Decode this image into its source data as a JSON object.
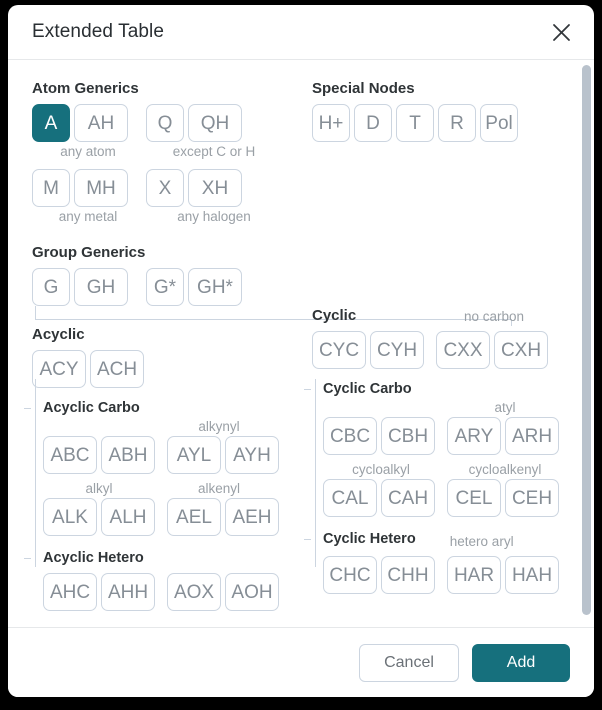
{
  "dialog": {
    "title": "Extended Table",
    "close_icon": "close-icon"
  },
  "sections": {
    "atom_generics": {
      "title": "Atom Generics",
      "row1": [
        {
          "label": "A",
          "selected": true
        },
        {
          "label": "AH",
          "selected": false
        },
        {
          "label": "Q",
          "selected": false
        },
        {
          "label": "QH",
          "selected": false
        }
      ],
      "row1_captions": [
        "any atom",
        "except C or H"
      ],
      "row2": [
        {
          "label": "M",
          "selected": false
        },
        {
          "label": "MH",
          "selected": false
        },
        {
          "label": "X",
          "selected": false
        },
        {
          "label": "XH",
          "selected": false
        }
      ],
      "row2_captions": [
        "any metal",
        "any halogen"
      ]
    },
    "special_nodes": {
      "title": "Special Nodes",
      "items": [
        {
          "label": "H+"
        },
        {
          "label": "D"
        },
        {
          "label": "T"
        },
        {
          "label": "R"
        },
        {
          "label": "Pol"
        }
      ]
    },
    "group_generics": {
      "title": "Group Generics",
      "items": [
        {
          "label": "G"
        },
        {
          "label": "GH"
        },
        {
          "label": "G*"
        },
        {
          "label": "GH*"
        }
      ]
    },
    "acyclic": {
      "title": "Acyclic",
      "items": [
        {
          "label": "ACY"
        },
        {
          "label": "ACH"
        }
      ],
      "carbo": {
        "title": "Acyclic Carbo",
        "row1_caption_right": "alkynyl",
        "row1": [
          {
            "label": "ABC"
          },
          {
            "label": "ABH"
          },
          {
            "label": "AYL"
          },
          {
            "label": "AYH"
          }
        ],
        "row2_caption_left": "alkyl",
        "row2_caption_right": "alkenyl",
        "row2": [
          {
            "label": "ALK"
          },
          {
            "label": "ALH"
          },
          {
            "label": "AEL"
          },
          {
            "label": "AEH"
          }
        ]
      },
      "hetero": {
        "title": "Acyclic Hetero",
        "row1": [
          {
            "label": "AHC"
          },
          {
            "label": "AHH"
          },
          {
            "label": "AOX"
          },
          {
            "label": "AOH"
          }
        ]
      }
    },
    "cyclic": {
      "title": "Cyclic",
      "caption_right": "no carbon",
      "items": [
        {
          "label": "CYC"
        },
        {
          "label": "CYH"
        },
        {
          "label": "CXX"
        },
        {
          "label": "CXH"
        }
      ],
      "carbo": {
        "title": "Cyclic Carbo",
        "row1_caption_right": "atyl",
        "row1": [
          {
            "label": "CBC"
          },
          {
            "label": "CBH"
          },
          {
            "label": "ARY"
          },
          {
            "label": "ARH"
          }
        ],
        "row2_caption_left": "cycloalkyl",
        "row2_caption_right": "cycloalkenyl",
        "row2": [
          {
            "label": "CAL"
          },
          {
            "label": "CAH"
          },
          {
            "label": "CEL"
          },
          {
            "label": "CEH"
          }
        ]
      },
      "hetero": {
        "title": "Cyclic Hetero",
        "row1_caption_right": "hetero aryl",
        "row1": [
          {
            "label": "CHC"
          },
          {
            "label": "CHH"
          },
          {
            "label": "HAR"
          },
          {
            "label": "HAH"
          }
        ]
      }
    }
  },
  "footer": {
    "cancel_label": "Cancel",
    "add_label": "Add"
  },
  "colors": {
    "accent": "#16707d",
    "chip_border": "#ccd5e0",
    "chip_text": "#868e96",
    "caption_text": "#9aa0a6",
    "scrollbar_thumb": "#b9c2cc"
  }
}
